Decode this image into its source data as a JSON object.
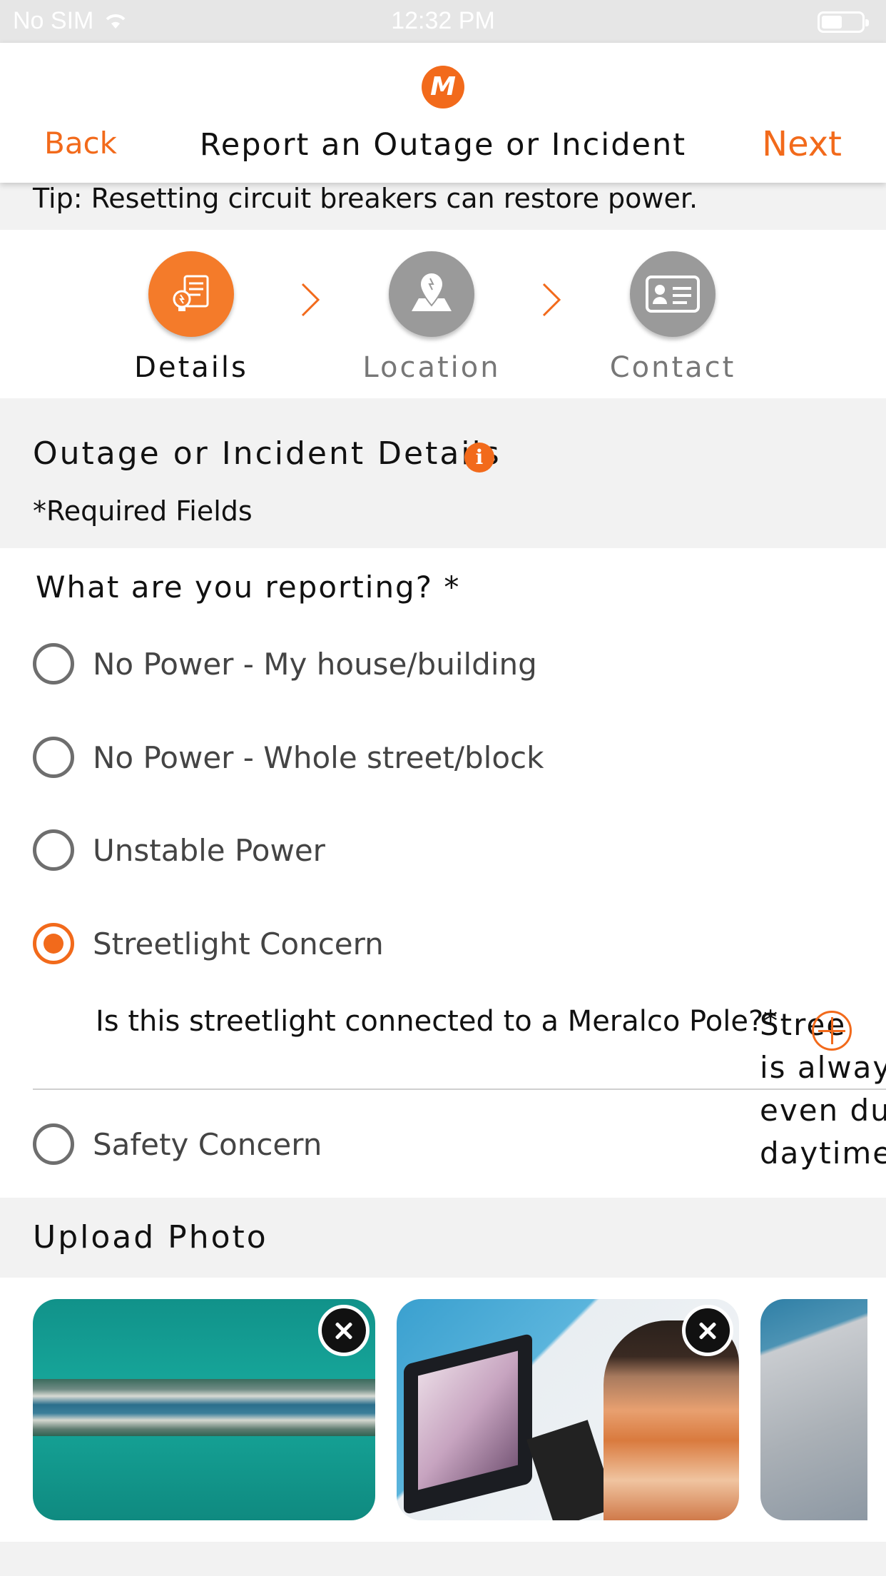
{
  "status_bar": {
    "carrier": "No SIM",
    "time": "12:32 PM"
  },
  "nav": {
    "back_label": "Back",
    "title": "Report an Outage or Incident",
    "next_label": "Next",
    "logo_icon": "meralco-logo-icon"
  },
  "tip": {
    "text": "Tip: Resetting circuit breakers can restore power."
  },
  "stepper": {
    "steps": [
      {
        "label": "Details",
        "icon": "lightbulb-document-icon",
        "active": true
      },
      {
        "label": "Location",
        "icon": "map-pin-icon",
        "active": false
      },
      {
        "label": "Contact",
        "icon": "id-card-icon",
        "active": false
      }
    ]
  },
  "details": {
    "title": "Outage or Incident Details",
    "required_note": "*Required Fields"
  },
  "form": {
    "question": "What are you reporting? *",
    "options": [
      {
        "label": "No Power - My house/building",
        "selected": false
      },
      {
        "label": "No Power - Whole street/block",
        "selected": false
      },
      {
        "label": "Unstable Power",
        "selected": false
      },
      {
        "label": "Streetlight Concern",
        "selected": true
      },
      {
        "label": "Safety Concern",
        "selected": false
      }
    ],
    "sub_question": "Is this streetlight connected to a Meralco Pole?*",
    "overflow_lines": [
      "Stree",
      "is alway",
      "even du",
      "daytime"
    ]
  },
  "upload": {
    "title": "Upload Photo",
    "photo_count": 3
  },
  "colors": {
    "accent": "#f26a1b",
    "inactive": "#9a9a9a",
    "background": "#f2f2f2"
  }
}
